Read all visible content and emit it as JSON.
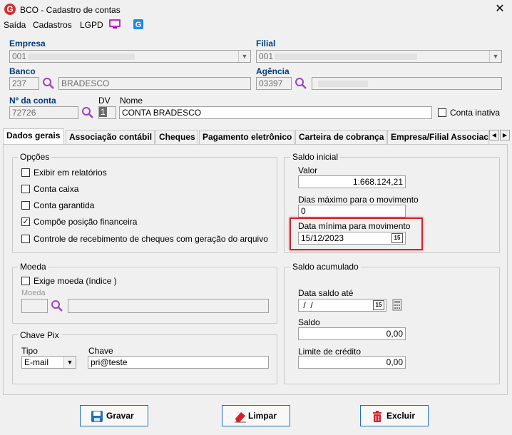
{
  "window": {
    "title": "BCO - Cadastro de contas",
    "app_icon_letter": "G"
  },
  "menu": {
    "items": [
      "Saída",
      "Cadastros",
      "LGPD"
    ]
  },
  "form": {
    "empresa_label": "Empresa",
    "empresa_value": "001",
    "filial_label": "Filial",
    "filial_value": "001",
    "banco_label": "Banco",
    "banco_code": "237",
    "banco_name": "BRADESCO",
    "agencia_label": "Agência",
    "agencia_code": "03397",
    "conta_label": "Nº da conta",
    "conta_value": "72726",
    "dv_label": "DV",
    "dv_value": "1",
    "nome_label": "Nome",
    "nome_value": "CONTA BRADESCO",
    "inativa_label": "Conta inativa"
  },
  "tabs": [
    "Dados gerais",
    "Associação contábil",
    "Cheques",
    "Pagamento eletrônico",
    "Carteira de cobrança",
    "Empresa/Filial Associac"
  ],
  "opcoes": {
    "title": "Opções",
    "items": [
      {
        "label": "Exibir em relatórios",
        "checked": false
      },
      {
        "label": "Conta caixa",
        "checked": false
      },
      {
        "label": "Conta garantida",
        "checked": false
      },
      {
        "label": "Compõe posição financeira",
        "checked": true
      },
      {
        "label": "Controle de recebimento de cheques com geração do arquivo",
        "checked": false
      }
    ]
  },
  "saldo_inicial": {
    "title": "Saldo inicial",
    "valor_label": "Valor",
    "valor_value": "1.668.124,21",
    "dias_label": "Dias máximo para o movimento",
    "dias_value": "0",
    "data_label": "Data mínima para movimento",
    "data_value": "15/12/2023"
  },
  "moeda": {
    "title": "Moeda",
    "exige_label": "Exige moeda (índice )",
    "moeda_label": "Moeda"
  },
  "chave_pix": {
    "title": "Chave Pix",
    "tipo_label": "Tipo",
    "tipo_value": "E-mail",
    "chave_label": "Chave",
    "chave_value": "pri@teste"
  },
  "saldo_acumulado": {
    "title": "Saldo acumulado",
    "data_label": "Data saldo até",
    "data_value": " /  /",
    "saldo_label": "Saldo",
    "saldo_value": "0,00",
    "limite_label": "Limite de crédito",
    "limite_value": "0,00"
  },
  "buttons": {
    "gravar": "Gravar",
    "limpar": "Limpar",
    "excluir": "Excluir"
  },
  "calendar_btn_label": "15",
  "colors": {
    "label_blue": "#003c80",
    "highlight_red": "#d8202a",
    "button_border": "#1f6fbf"
  }
}
